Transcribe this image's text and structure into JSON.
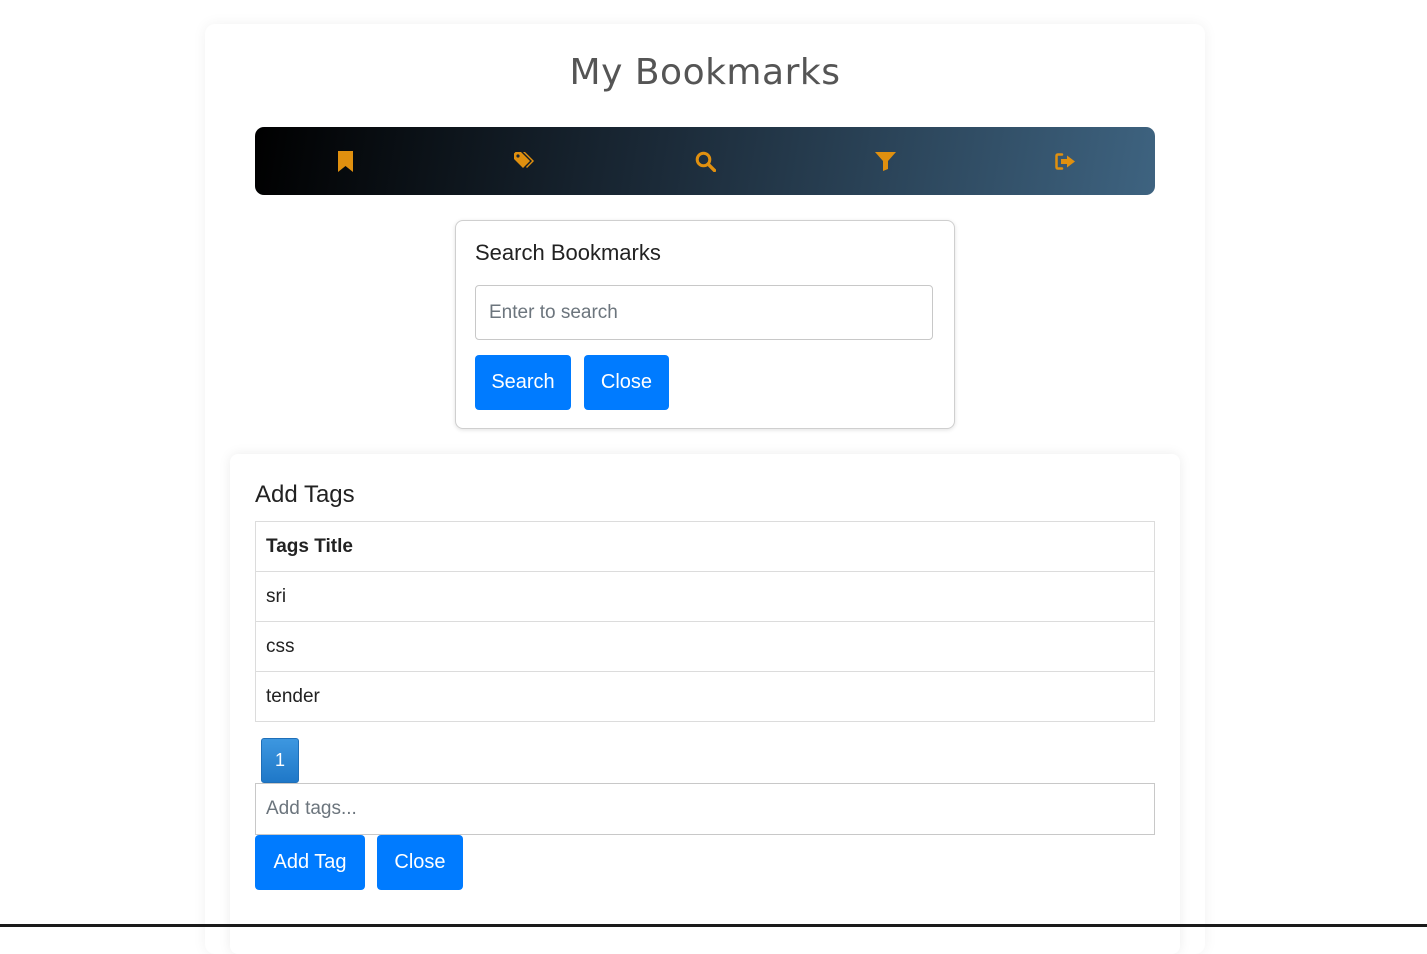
{
  "header": {
    "title": "My Bookmarks"
  },
  "navbar": {
    "items": [
      {
        "icon": "bookmark-icon"
      },
      {
        "icon": "tags-icon"
      },
      {
        "icon": "search-icon"
      },
      {
        "icon": "filter-icon"
      },
      {
        "icon": "logout-icon"
      }
    ],
    "icon_color": "#e0900f"
  },
  "search_panel": {
    "title": "Search Bookmarks",
    "placeholder": "Enter to search",
    "value": "",
    "search_label": "Search",
    "close_label": "Close"
  },
  "tags_panel": {
    "title": "Add Tags",
    "column_header": "Tags Title",
    "rows": [
      "sri",
      "css",
      "tender"
    ],
    "pagination": {
      "current_page": "1"
    },
    "input_placeholder": "Add tags...",
    "input_value": "",
    "add_label": "Add Tag",
    "close_label": "Close"
  },
  "colors": {
    "primary": "#007bff",
    "accent": "#e0900f"
  }
}
